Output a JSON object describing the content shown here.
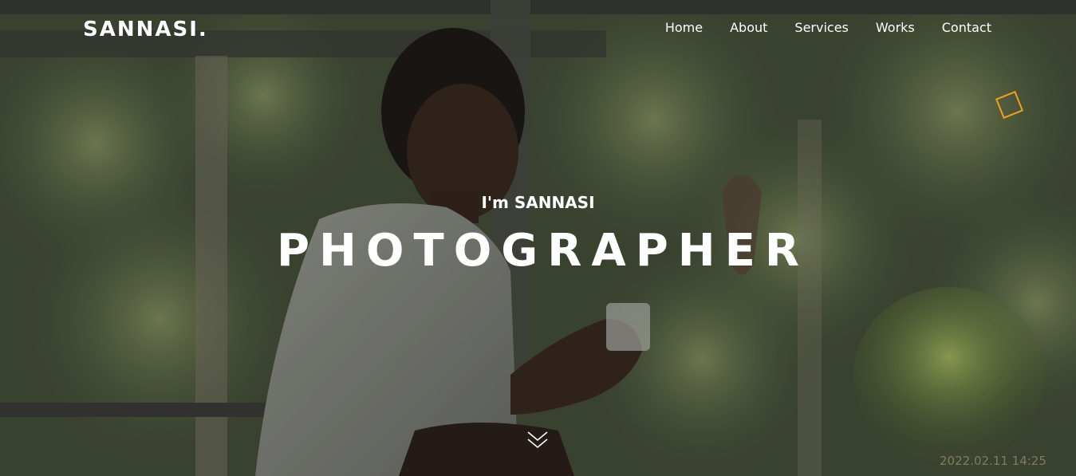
{
  "brand": {
    "logo_text": "SANNASI."
  },
  "nav": {
    "items": [
      {
        "label": "Home"
      },
      {
        "label": "About"
      },
      {
        "label": "Services"
      },
      {
        "label": "Works"
      },
      {
        "label": "Contact"
      }
    ]
  },
  "hero": {
    "intro": "I'm SANNASI",
    "headline": "PHOTOGRAPHER",
    "photo_timestamp": "2022.02.11 14:25",
    "scroll_icon": "double-chevron-down-icon",
    "decoration_icon": "diamond-outline-icon"
  },
  "colors": {
    "accent": "#f0a020",
    "text": "#ffffff"
  }
}
